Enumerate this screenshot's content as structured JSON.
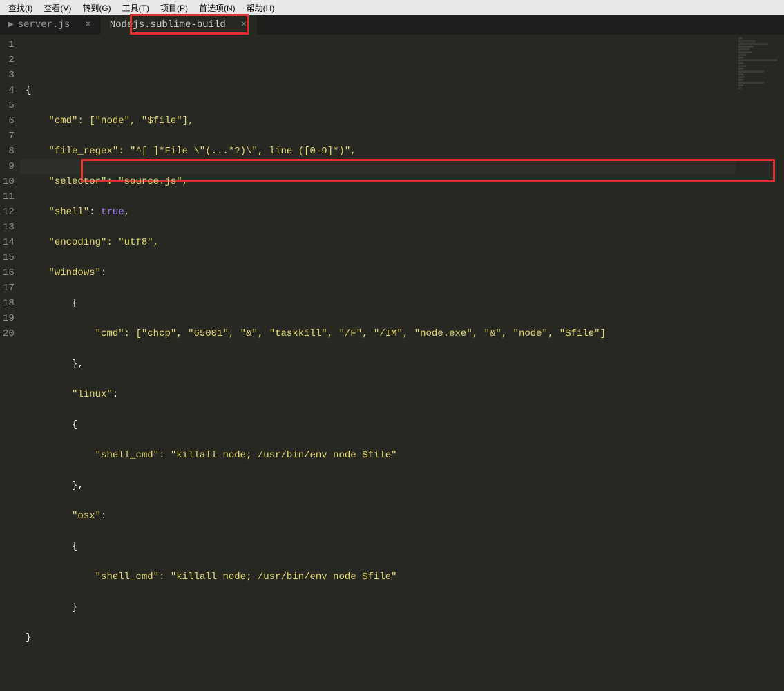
{
  "menubar": {
    "items": [
      "查找(I)",
      "查看(V)",
      "转到(G)",
      "工具(T)",
      "项目(P)",
      "首选项(N)",
      "帮助(H)"
    ]
  },
  "tabs": [
    {
      "label": "server.js",
      "active": false
    },
    {
      "label": "Nodejs.sublime-build",
      "active": true
    }
  ],
  "gutter_start": 1,
  "gutter_count": 20,
  "code": {
    "l1": "{",
    "l2_key": "\"cmd\"",
    "l2_rest": ": [\"node\", \"$file\"],",
    "l3_key": "\"file_regex\"",
    "l3_rest": ": \"^[ ]*File \\\"(...*?)\\\", line ([0-9]*)\",",
    "l4_key": "\"selector\"",
    "l4_rest": ": \"source.js\",",
    "l5_key": "\"shell\"",
    "l5_rest": ": ",
    "l5_bool": "true",
    "l5_end": ",",
    "l6_key": "\"encoding\"",
    "l6_rest": ": \"utf8\",",
    "l7_key": "\"windows\"",
    "l7_rest": ":",
    "l8": "{",
    "l9_key": "\"cmd\"",
    "l9_rest": ": [\"chcp\", \"65001\", \"&\", \"taskkill\", \"/F\", \"/IM\", \"node.exe\", \"&\", \"node\", \"$file\"]",
    "l10": "},",
    "l11_key": "\"linux\"",
    "l11_rest": ":",
    "l12": "{",
    "l13_key": "\"shell_cmd\"",
    "l13_rest": ": \"killall node; /usr/bin/env node $file\"",
    "l14": "},",
    "l15_key": "\"osx\"",
    "l15_rest": ":",
    "l16": "{",
    "l17_key": "\"shell_cmd\"",
    "l17_rest": ": \"killall node; /usr/bin/env node $file\"",
    "l18": "}",
    "l19": "}"
  }
}
